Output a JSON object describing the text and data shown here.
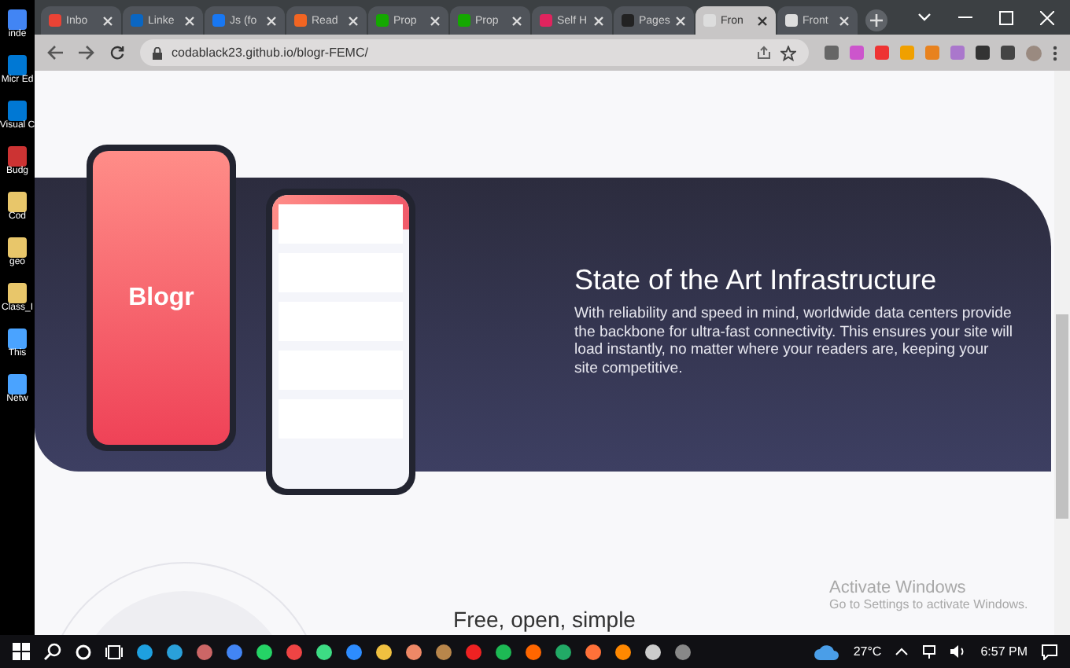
{
  "desktop_icons": [
    {
      "label": "inde"
    },
    {
      "label": "Micr Ed"
    },
    {
      "label": "Visual C"
    },
    {
      "label": "Budg"
    },
    {
      "label": "Cod"
    },
    {
      "label": "geo"
    },
    {
      "label": "Class_I"
    },
    {
      "label": "This"
    },
    {
      "label": "Netw"
    }
  ],
  "browser": {
    "tabs": [
      {
        "label": "Inbo",
        "selected": false
      },
      {
        "label": "Linke",
        "selected": false
      },
      {
        "label": "Js (fo",
        "selected": false
      },
      {
        "label": "Read",
        "selected": false
      },
      {
        "label": "Prop",
        "selected": false
      },
      {
        "label": "Prop",
        "selected": false
      },
      {
        "label": "Self H",
        "selected": false
      },
      {
        "label": "Pages",
        "selected": false
      },
      {
        "label": "Fron",
        "selected": true
      },
      {
        "label": "Front",
        "selected": false
      }
    ],
    "url": "codablack23.github.io/blogr-FEMC/"
  },
  "page": {
    "phone_logo": "Blogr",
    "feature": {
      "title": "State of the Art Infrastructure",
      "body": "With reliability and speed in mind, worldwide data centers provide the backbone for ultra-fast connectivity. This ensures your site will load instantly, no matter where your readers are, keeping your site competitive."
    },
    "next_heading": "Free, open, simple"
  },
  "activation_notice": {
    "title": "Activate Windows",
    "subtitle": "Go to Settings to activate Windows."
  },
  "taskbar": {
    "temperature": "27°C",
    "time": "6:57 PM"
  }
}
